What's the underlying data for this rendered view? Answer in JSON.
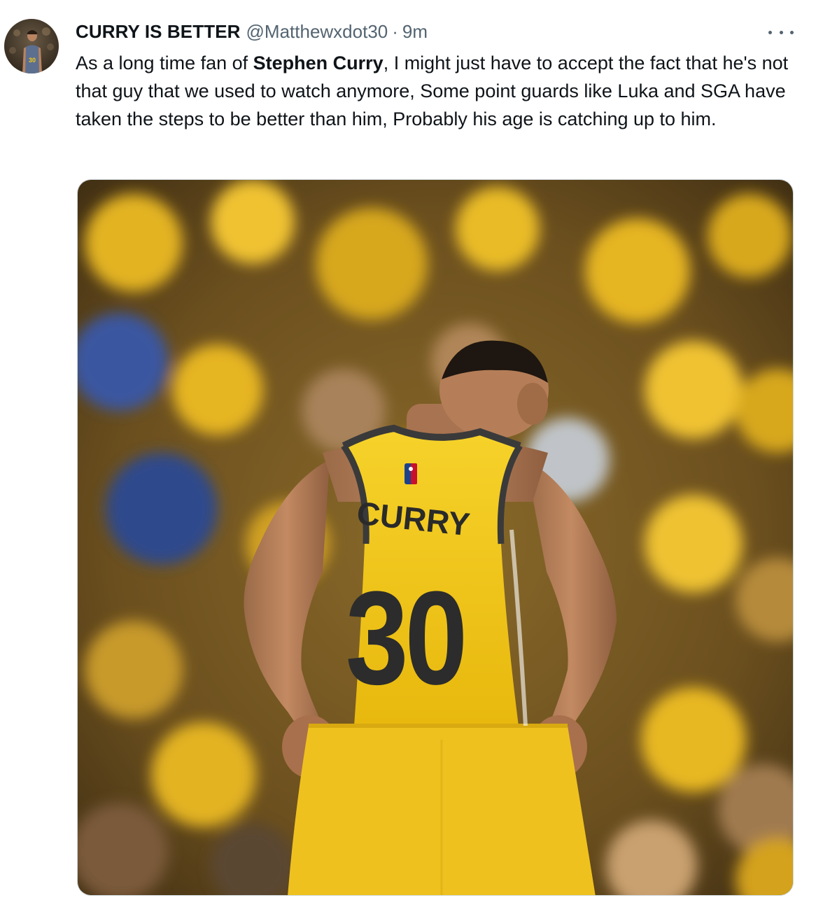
{
  "tweet": {
    "display_name": "CURRY IS BETTER",
    "handle": "@Matthewxdot30",
    "separator": "·",
    "time": "9m",
    "text_before": "As a long time fan of ",
    "text_bold": "Stephen Curry",
    "text_after": ", I might just have to accept the fact that he's not that guy that we used to watch anymore, Some point guards like Luka and SGA have taken the steps to be better than him, Probably his age is catching up to him.",
    "media": {
      "jersey_name": "CURRY",
      "jersey_number": "30"
    }
  },
  "colors": {
    "text_primary": "#0f1419",
    "text_secondary": "#536471",
    "jersey_yellow": "#f4c919",
    "jersey_trim": "#3a3a3a"
  },
  "icons": {
    "more": "more-horizontal-icon",
    "nba_logo": "nba-logo-icon"
  }
}
